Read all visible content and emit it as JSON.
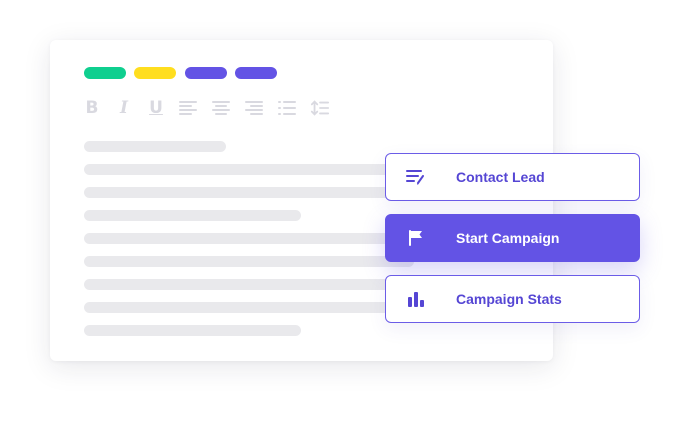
{
  "colors": {
    "accent": "#6353e5",
    "tag_green": "#0fcf8f",
    "tag_yellow": "#ffde1f",
    "tag_purple": "#6353e5",
    "placeholder_line": "#e9e9ec",
    "toolbar_icon": "#d9d9e0"
  },
  "editor": {
    "color_tags": [
      "green",
      "yellow",
      "purple",
      "purple"
    ],
    "toolbar": {
      "bold_label": "B",
      "italic_label": "I",
      "underline_label": "U",
      "icons": [
        "bold-icon",
        "italic-icon",
        "underline-icon",
        "align-left-icon",
        "align-center-icon",
        "align-right-icon",
        "bulleted-list-icon",
        "line-height-icon"
      ]
    }
  },
  "actions": [
    {
      "label": "Contact Lead",
      "icon": "edit-list-icon",
      "active": false
    },
    {
      "label": "Start Campaign",
      "icon": "flag-icon",
      "active": true
    },
    {
      "label": "Campaign Stats",
      "icon": "bar-chart-icon",
      "active": false
    }
  ]
}
